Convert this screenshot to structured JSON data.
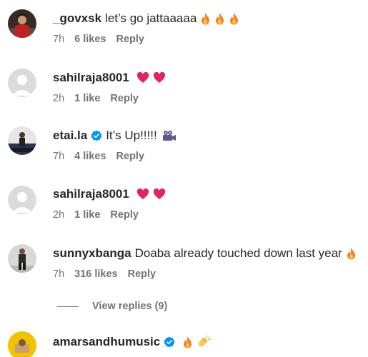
{
  "comments": [
    {
      "username": "_govxsk",
      "text": "let’s go jattaaaaa",
      "emojis": [
        "fire-icon",
        "fire-icon",
        "fire-icon"
      ],
      "time": "7h",
      "likes": "6 likes",
      "reply": "Reply"
    },
    {
      "username": "sahilraja8001",
      "text": "",
      "emojis": [
        "red-heart-icon",
        "red-heart-icon"
      ],
      "time": "2h",
      "likes": "1 like",
      "reply": "Reply"
    },
    {
      "username": "etai.la",
      "verified": true,
      "text": "It’s Up!!!!!",
      "emojis": [
        "movie-camera-icon"
      ],
      "time": "7h",
      "likes": "4 likes",
      "reply": "Reply"
    },
    {
      "username": "sahilraja8001",
      "text": "",
      "emojis": [
        "red-heart-icon",
        "red-heart-icon"
      ],
      "time": "2h",
      "likes": "1 like",
      "reply": "Reply"
    },
    {
      "username": "sunnyxbanga",
      "text": "Doaba already touched down last year",
      "emojis": [
        "fire-icon"
      ],
      "time": "7h",
      "likes": "316 likes",
      "reply": "Reply"
    },
    {
      "username": "amarsandhumusic",
      "verified": true,
      "text": "",
      "emojis": [
        "fire-icon",
        "clapping-hands-icon"
      ]
    }
  ],
  "view_replies": "View replies (9)",
  "colors": {
    "text": "#262626",
    "secondary": "#737373",
    "verified": "#0095f6",
    "heart": "#e0245e",
    "fire": "#f58220"
  }
}
